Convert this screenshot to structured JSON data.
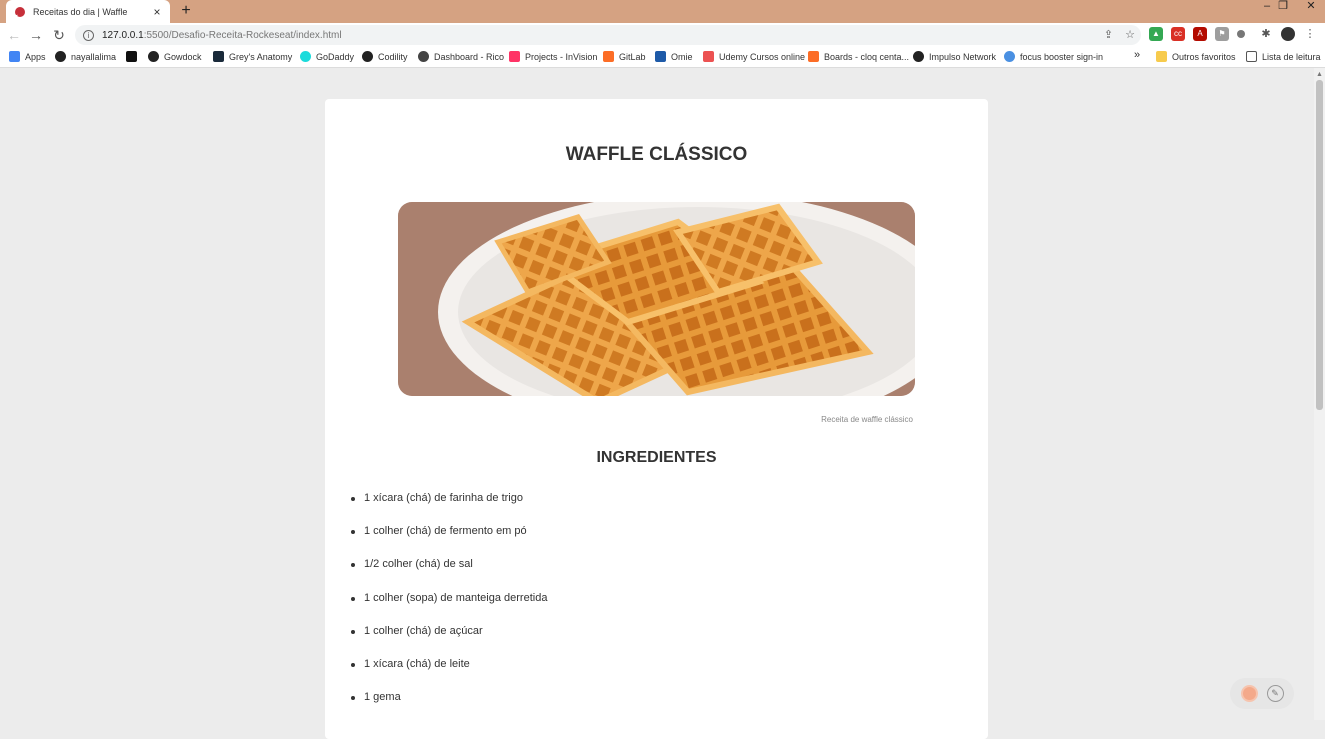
{
  "browser": {
    "tab_title": "Receitas do dia | Waffle",
    "tab_close": "×",
    "new_tab": "+",
    "url_host": "127.0.0.1",
    "url_path": ":5500/Desafio-Receita-Rockeseat/index.html",
    "win_min": "–",
    "win_max": "❐",
    "win_close": "✕"
  },
  "bookmarks": [
    {
      "label": "Apps",
      "color": "#4285f4"
    },
    {
      "label": "nayallalima",
      "color": "#222222"
    },
    {
      "label": "",
      "color": "#111111"
    },
    {
      "label": "Gowdock",
      "color": "#222222"
    },
    {
      "label": "Grey's Anatomy",
      "color": "#1a2a3a"
    },
    {
      "label": "GoDaddy",
      "color": "#1bdbdb"
    },
    {
      "label": "Codility",
      "color": "#222222"
    },
    {
      "label": "Dashboard - Rico",
      "color": "#444444"
    },
    {
      "label": "Projects - InVision",
      "color": "#ff3366"
    },
    {
      "label": "GitLab",
      "color": "#fc6d26"
    },
    {
      "label": "Omie",
      "color": "#1e5aa8"
    },
    {
      "label": "Udemy Cursos online",
      "color": "#ec5252"
    },
    {
      "label": "Boards - cloq centa...",
      "color": "#fc6d26"
    },
    {
      "label": "Impulso Network",
      "color": "#222222"
    },
    {
      "label": "focus booster sign-in",
      "color": "#4a90e2"
    }
  ],
  "bookmarks_overflow": "»",
  "other_bookmarks": "Outros favoritos",
  "reading_list": "Lista de leitura",
  "recipe": {
    "title": "WAFFLE CLÁSSICO",
    "image_caption": "Receita de waffle clássico",
    "ingredients_title": "INGREDIENTES",
    "ingredients": [
      "1 xícara (chá) de farinha de trigo",
      "1 colher (chá) de fermento em pó",
      "1/2 colher (chá) de sal",
      "1 colher (sopa) de manteiga derretida",
      "1 colher (chá) de açúcar",
      "1 xícara (chá) de leite",
      "1 gema"
    ]
  }
}
